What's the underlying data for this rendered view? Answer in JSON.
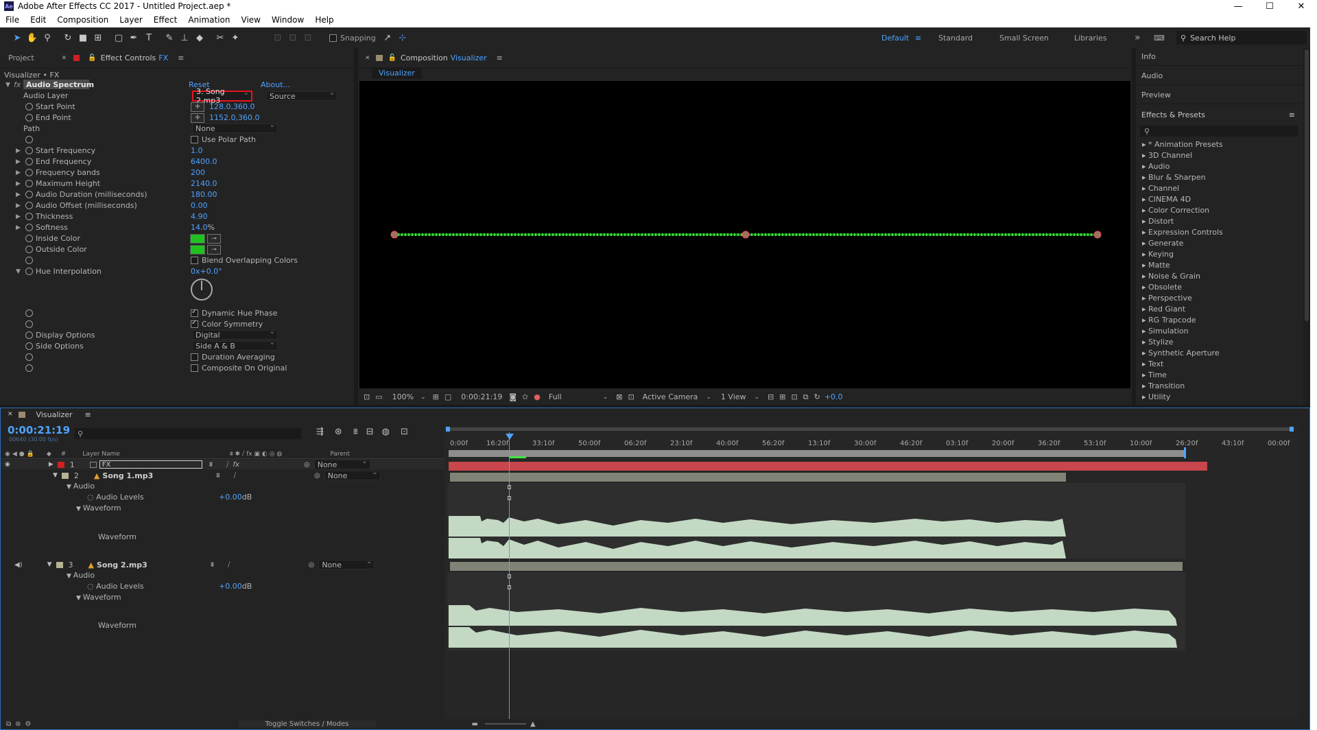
{
  "window": {
    "title": "Adobe After Effects CC 2017 - Untitled Project.aep *",
    "app_icon": "Ae",
    "minimize": "—",
    "maximize": "☐",
    "close": "✕"
  },
  "menu": [
    "File",
    "Edit",
    "Composition",
    "Layer",
    "Effect",
    "Animation",
    "View",
    "Window",
    "Help"
  ],
  "toolbar": {
    "snapping_label": "Snapping",
    "workspaces": [
      "Default",
      "Standard",
      "Small Screen",
      "Libraries"
    ],
    "workspace_more": "»",
    "search_placeholder": "Search Help"
  },
  "effect_controls": {
    "tab_project": "Project",
    "tab_effect": "Effect Controls",
    "tab_effect_target": "FX",
    "breadcrumb": "Visualizer • FX",
    "fx_badge": "fx",
    "effect_name": "Audio Spectrum",
    "reset": "Reset",
    "about": "About...",
    "audio_layer_label": "Audio Layer",
    "audio_layer_value": "3. Song 2.mp3",
    "audio_layer_source": "Source",
    "start_point_label": "Start Point",
    "start_point_value": "128.0,360.0",
    "end_point_label": "End Point",
    "end_point_value": "1152.0,360.0",
    "path_label": "Path",
    "path_value": "None",
    "use_polar_path": "Use Polar Path",
    "props": [
      {
        "label": "Start Frequency",
        "value": "1.0"
      },
      {
        "label": "End Frequency",
        "value": "6400.0"
      },
      {
        "label": "Frequency bands",
        "value": "200"
      },
      {
        "label": "Maximum Height",
        "value": "2140.0"
      },
      {
        "label": "Audio Duration (milliseconds)",
        "value": "180.00"
      },
      {
        "label": "Audio Offset (milliseconds)",
        "value": "0.00"
      },
      {
        "label": "Thickness",
        "value": "4.90"
      },
      {
        "label": "Softness",
        "value": "14.0",
        "unit": "%"
      }
    ],
    "inside_color_label": "Inside Color",
    "outside_color_label": "Outside Color",
    "blend_overlapping": "Blend Overlapping Colors",
    "hue_interp_label": "Hue Interpolation",
    "hue_interp_value": "0x+0.0°",
    "dynamic_hue_phase": "Dynamic Hue Phase",
    "color_symmetry": "Color Symmetry",
    "display_options_label": "Display Options",
    "display_options_value": "Digital",
    "side_options_label": "Side Options",
    "side_options_value": "Side A & B",
    "duration_averaging": "Duration Averaging",
    "composite_on_original": "Composite On Original"
  },
  "composition": {
    "tab_prefix": "Composition",
    "tab_name": "Visualizer",
    "subtab": "Visualizer",
    "zoom": "100%",
    "timecode": "0:00:21:19",
    "resolution": "Full",
    "camera": "Active Camera",
    "view": "1 View",
    "exposure": "+0.0"
  },
  "right_panels": {
    "info": "Info",
    "audio": "Audio",
    "preview": "Preview",
    "effects_presets": "Effects & Presets",
    "search_placeholder": "",
    "categories": [
      "* Animation Presets",
      "3D Channel",
      "Audio",
      "Blur & Sharpen",
      "Channel",
      "CINEMA 4D",
      "Color Correction",
      "Distort",
      "Expression Controls",
      "Generate",
      "Keying",
      "Matte",
      "Noise & Grain",
      "Obsolete",
      "Perspective",
      "Red Giant",
      "RG Trapcode",
      "Simulation",
      "Stylize",
      "Synthetic Aperture",
      "Text",
      "Time",
      "Transition",
      "Utility"
    ]
  },
  "timeline": {
    "tab_name": "Visualizer",
    "timecode": "0:00:21:19",
    "timecode_sub": "00640 (30.00 fps)",
    "search_placeholder": "",
    "col_hash": "#",
    "col_layer_name": "Layer Name",
    "col_parent": "Parent",
    "ruler": [
      "0:00f",
      "16:20f",
      "33:10f",
      "50:00f",
      "06:20f",
      "23:10f",
      "40:00f",
      "56:20f",
      "13:10f",
      "30:00f",
      "46:20f",
      "03:10f",
      "20:00f",
      "36:20f",
      "53:10f",
      "10:00f",
      "26:20f",
      "43:10f",
      "00:00f"
    ],
    "layers": [
      {
        "num": "1",
        "name": "FX",
        "parent": "None"
      },
      {
        "num": "2",
        "name": "Song 1.mp3",
        "parent": "None"
      },
      {
        "num": "3",
        "name": "Song 2.mp3",
        "parent": "None"
      }
    ],
    "audio": "Audio",
    "audio_levels": "Audio Levels",
    "audio_levels_value": "+0.00",
    "audio_levels_unit": "dB",
    "waveform_group": "Waveform",
    "waveform": "Waveform",
    "toggle_switches": "Toggle Switches / Modes"
  }
}
